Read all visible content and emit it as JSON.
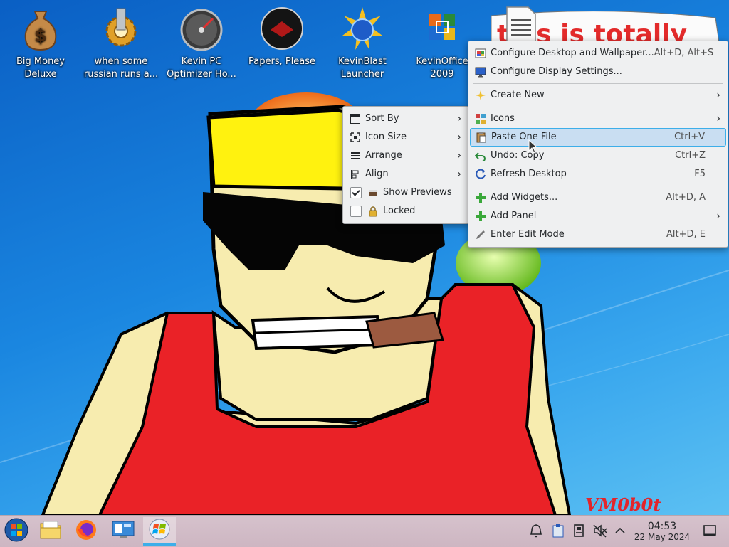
{
  "desktop_icons": [
    {
      "label": "Big Money Deluxe",
      "icon": "money-bag-icon"
    },
    {
      "label": "when some russian runs a...",
      "icon": "gear-icon"
    },
    {
      "label": "Kevin PC Optimizer Ho...",
      "icon": "speedometer-icon"
    },
    {
      "label": "Papers, Please",
      "icon": "papers-please-icon"
    },
    {
      "label": "KevinBlast Launcher",
      "icon": "globe-starburst-icon"
    },
    {
      "label": "KevinOffice 2009",
      "icon": "office-icon"
    }
  ],
  "wallpaper_text": {
    "headline": "this is totally",
    "signature": "VM0b0t"
  },
  "context_menu": {
    "items": [
      {
        "label": "Configure Desktop and Wallpaper...",
        "shortcut": "Alt+D, Alt+S"
      },
      {
        "label": "Configure Display Settings...",
        "shortcut": ""
      },
      {
        "label": "Create New",
        "shortcut": "",
        "submenu": true
      },
      {
        "label": "Icons",
        "shortcut": "",
        "submenu": true
      },
      {
        "label": "Paste One File",
        "shortcut": "Ctrl+V",
        "highlighted": true
      },
      {
        "label": "Undo: Copy",
        "shortcut": "Ctrl+Z"
      },
      {
        "label": "Refresh Desktop",
        "shortcut": "F5"
      },
      {
        "label": "Add Widgets...",
        "shortcut": "Alt+D, A"
      },
      {
        "label": "Add Panel",
        "shortcut": "",
        "submenu": true
      },
      {
        "label": "Enter Edit Mode",
        "shortcut": "Alt+D, E"
      }
    ]
  },
  "icons_submenu": {
    "items": [
      {
        "label": "Sort By",
        "submenu": true
      },
      {
        "label": "Icon Size",
        "submenu": true
      },
      {
        "label": "Arrange",
        "submenu": true
      },
      {
        "label": "Align",
        "submenu": true
      },
      {
        "label": "Show Previews",
        "checked": true
      },
      {
        "label": "Locked",
        "checked": false
      }
    ]
  },
  "taskbar": {
    "apps": [
      "start-orb-icon",
      "file-manager-icon",
      "firefox-icon",
      "system-settings-icon",
      "windows-flag-icon"
    ],
    "tray": [
      "notifications-bell-icon",
      "clipboard-icon",
      "storage-device-icon",
      "volume-muted-icon",
      "tray-expand-icon"
    ],
    "clock_time": "04:53",
    "clock_date": "22 May 2024"
  },
  "colors": {
    "accent": "#3daee9",
    "highlight": "#c9def2",
    "menu_bg": "#eff0f1"
  }
}
